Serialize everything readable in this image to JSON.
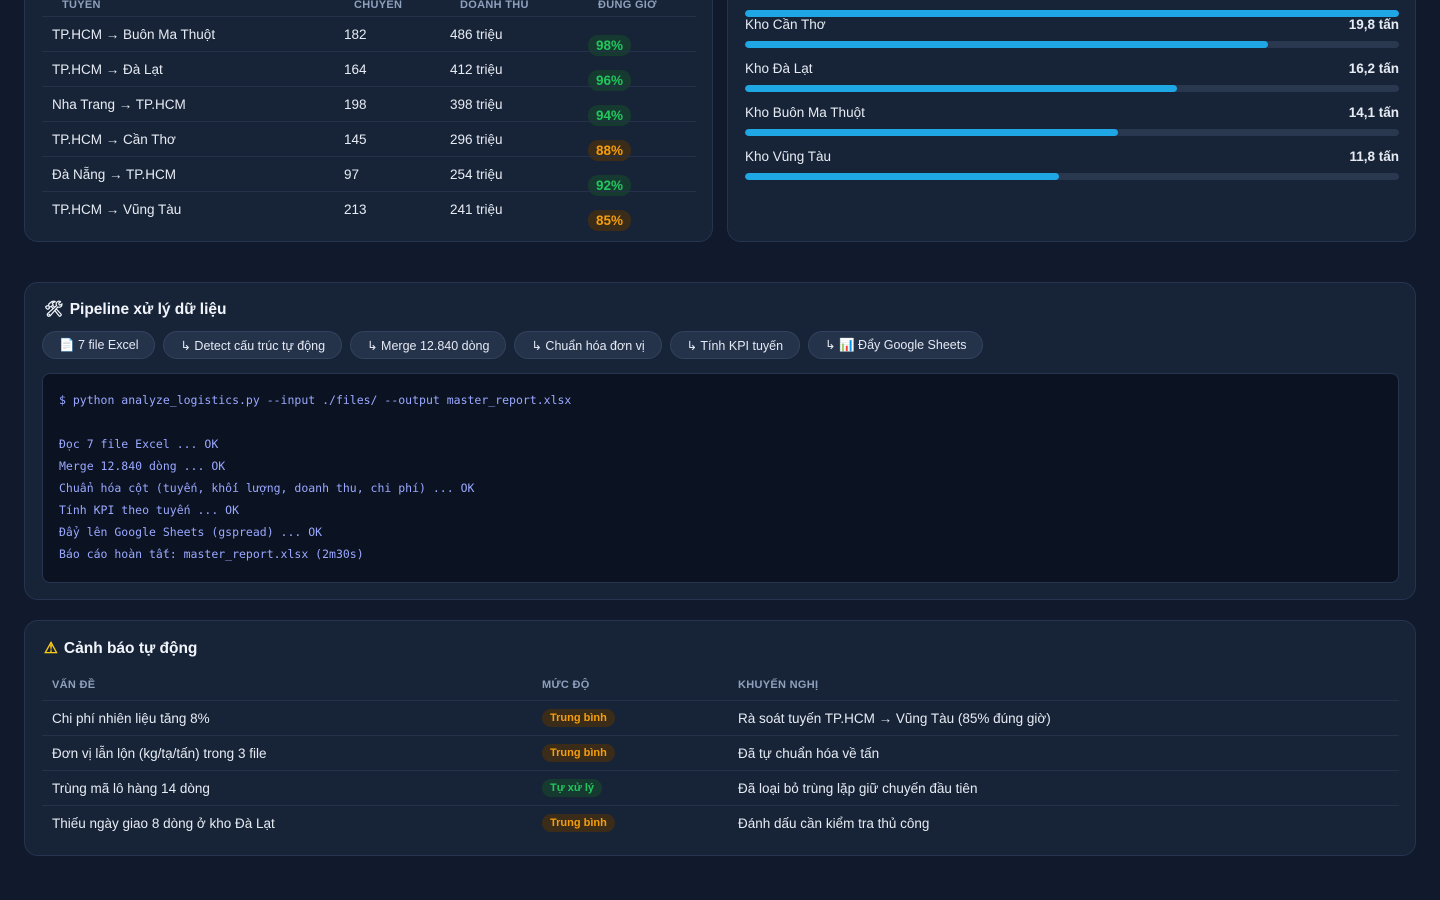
{
  "routes": {
    "headers": [
      "TUYẾN",
      "CHUYẾN",
      "DOANH THU",
      "ĐÚNG GIỜ"
    ],
    "rows": [
      {
        "route": "TP.HCM → Buôn Ma Thuột",
        "trips": "182",
        "revenue": "486 triệu",
        "ontime": "98%",
        "status": "green"
      },
      {
        "route": "TP.HCM → Đà Lạt",
        "trips": "164",
        "revenue": "412 triệu",
        "ontime": "96%",
        "status": "green"
      },
      {
        "route": "Nha Trang → TP.HCM",
        "trips": "198",
        "revenue": "398 triệu",
        "ontime": "94%",
        "status": "green"
      },
      {
        "route": "TP.HCM → Cần Thơ",
        "trips": "145",
        "revenue": "296 triệu",
        "ontime": "88%",
        "status": "orange"
      },
      {
        "route": "Đà Nẵng → TP.HCM",
        "trips": "97",
        "revenue": "254 triệu",
        "ontime": "92%",
        "status": "green"
      },
      {
        "route": "TP.HCM → Vũng Tàu",
        "trips": "213",
        "revenue": "241 triệu",
        "ontime": "85%",
        "status": "orange"
      }
    ]
  },
  "warehouses": {
    "items": [
      {
        "name": "",
        "value": "",
        "fill": 1.0
      },
      {
        "name": "Kho Cần Thơ",
        "value": "19,8 tấn",
        "fill": 0.8
      },
      {
        "name": "Kho Đà Lạt",
        "value": "16,2 tấn",
        "fill": 0.66
      },
      {
        "name": "Kho Buôn Ma Thuột",
        "value": "14,1 tấn",
        "fill": 0.57
      },
      {
        "name": "Kho Vũng Tàu",
        "value": "11,8 tấn",
        "fill": 0.48
      }
    ]
  },
  "pipeline": {
    "icon": "🛠",
    "title": "Pipeline xử lý dữ liệu",
    "steps": [
      "📄 7 file Excel",
      "↳ Detect cấu trúc tự động",
      "↳ Merge 12.840 dòng",
      "↳ Chuẩn hóa đơn vị",
      "↳ Tính KPI tuyến",
      "↳ 📊 Đẩy Google Sheets"
    ],
    "terminal": [
      "$ python analyze_logistics.py --input ./files/ --output master_report.xlsx",
      "",
      "Đọc 7 file Excel ... OK",
      "Merge 12.840 dòng ... OK",
      "Chuẩn hóa cột (tuyến, khối lượng, doanh thu, chi phí) ... OK",
      "Tính KPI theo tuyến ... OK",
      "Đẩy lên Google Sheets (gspread) ... OK",
      "Báo cáo hoàn tất: master_report.xlsx (2m30s)"
    ]
  },
  "alerts": {
    "icon": "⚠",
    "title": "Cảnh báo tự động",
    "headers": [
      "VẤN ĐỀ",
      "MỨC ĐỘ",
      "KHUYẾN NGHỊ"
    ],
    "rows": [
      {
        "issue": "Chi phí nhiên liệu tăng 8%",
        "level": "Trung bình",
        "level_color": "orange",
        "advice": "Rà soát tuyến TP.HCM → Vũng Tàu (85% đúng giờ)"
      },
      {
        "issue": "Đơn vị lẫn lộn (kg/tạ/tấn) trong 3 file",
        "level": "Trung bình",
        "level_color": "orange",
        "advice": "Đã tự chuẩn hóa về tấn"
      },
      {
        "issue": "Trùng mã lô hàng 14 dòng",
        "level": "Tự xử lý",
        "level_color": "green",
        "advice": "Đã loại bỏ trùng lặp giữ chuyến đầu tiên"
      },
      {
        "issue": "Thiếu ngày giao 8 dòng ở kho Đà Lạt",
        "level": "Trung bình",
        "level_color": "orange",
        "advice": "Đánh dấu cần kiểm tra thủ công"
      }
    ]
  }
}
